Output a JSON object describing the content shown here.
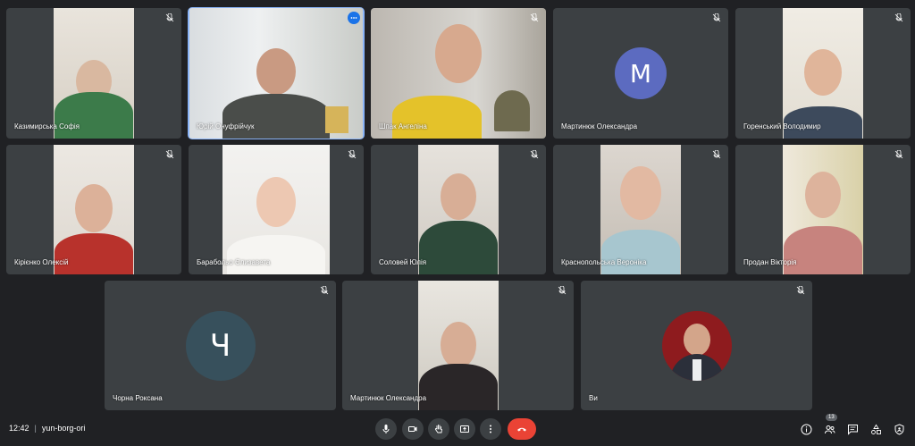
{
  "participants": [
    {
      "name": "Казимирська Софія",
      "muted": true
    },
    {
      "name": "Юрій Онуфрійчук",
      "muted": false,
      "speaking": true
    },
    {
      "name": "Шпак Ангеліна",
      "muted": true
    },
    {
      "name": "Мартинюк Олександра",
      "muted": true,
      "avatar_letter": "M",
      "avatar_color": "#5c6bc0"
    },
    {
      "name": "Горенський Володимир",
      "muted": true
    },
    {
      "name": "Кірієнко Олексій",
      "muted": true
    },
    {
      "name": "Барабольо Єлизавета",
      "muted": true
    },
    {
      "name": "Соловей Юлія",
      "muted": true
    },
    {
      "name": "Краснопольська Вероніка",
      "muted": true
    },
    {
      "name": "Продан Вікторія",
      "muted": true
    },
    {
      "name": "Чорна Роксана",
      "muted": true,
      "avatar_letter": "Ч",
      "avatar_color": "#37505c"
    },
    {
      "name": "Мартинюк Олександра",
      "muted": true
    },
    {
      "name": "Ви",
      "muted": true
    }
  ],
  "meeting": {
    "time": "12:42",
    "separator": "|",
    "code": "yun-borg-ori"
  },
  "controls": [
    "mic-icon",
    "camera-icon",
    "raise-hand-icon",
    "present-icon",
    "more-options-icon",
    "end-call-icon"
  ],
  "right_controls": {
    "people_count": "13",
    "icons": [
      "info-icon",
      "people-icon",
      "chat-icon",
      "activities-icon",
      "host-controls-icon"
    ]
  },
  "colors": {
    "background": "#202124",
    "tile": "#3c4043",
    "active_outline": "#8ab4f8",
    "end_call": "#ea4335"
  }
}
